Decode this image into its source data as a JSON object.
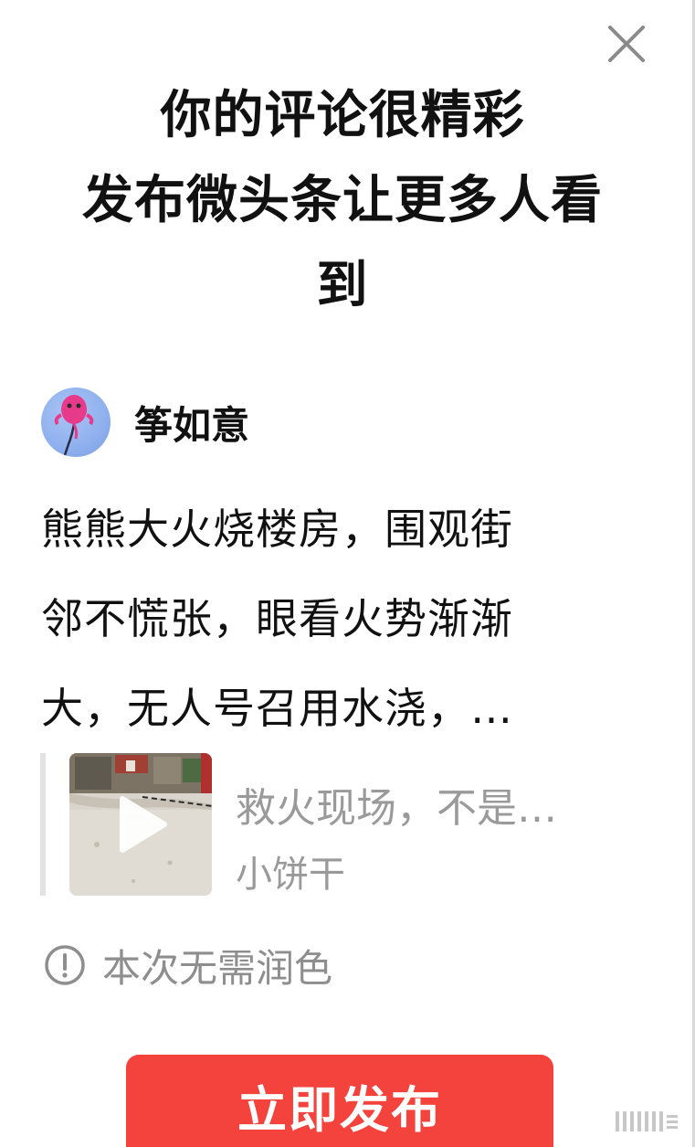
{
  "dialog": {
    "close_icon": "close-icon",
    "headline_lines": [
      "你的评论很精彩",
      "发布微头条让更多人看",
      "到"
    ]
  },
  "author": {
    "avatar_icon": "kite-avatar",
    "name": "筝如意"
  },
  "comment": {
    "lines": [
      "熊熊大火烧楼房，围观街",
      "邻不慌张，眼看火势渐渐",
      "大，无人号召用水浇，…"
    ]
  },
  "quoted_post": {
    "title": "救火现场，不是…",
    "author": "小饼干",
    "thumbnail_icon": "play-icon"
  },
  "notice": {
    "icon": "info-icon",
    "text": "本次无需润色"
  },
  "publish_button": {
    "label": "立即发布",
    "color": "#f3433c"
  },
  "colors": {
    "primary_text": "#111111",
    "muted_text": "#9a9a9a",
    "accent": "#f3433c"
  }
}
